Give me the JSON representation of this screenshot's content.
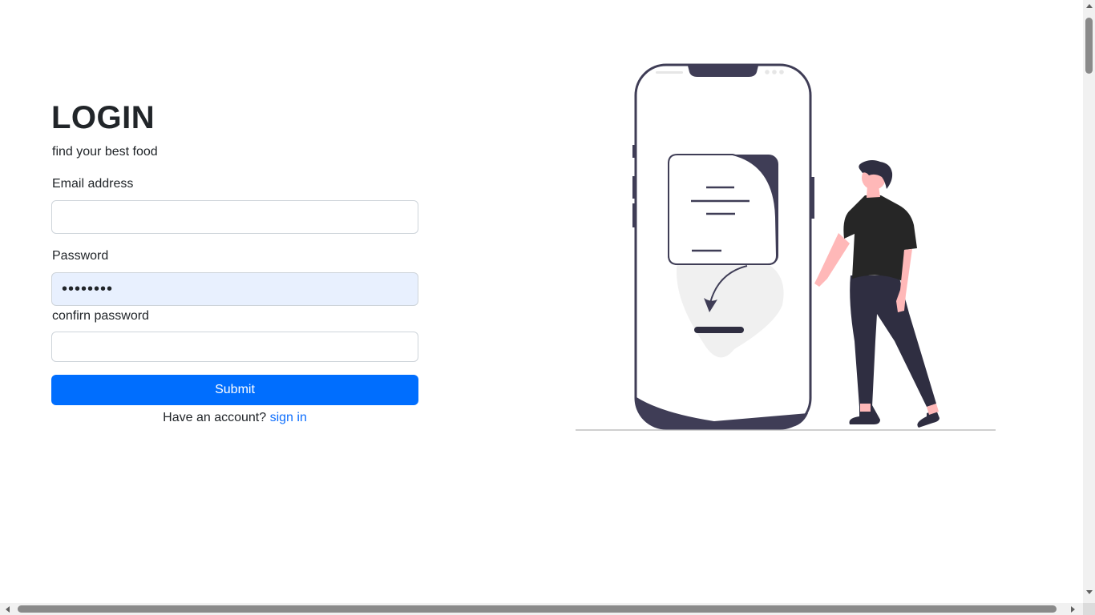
{
  "login": {
    "title": "LOGIN",
    "subtitle": "find your best food",
    "email_label": "Email address",
    "email_value": "",
    "password_label": "Password",
    "password_value": "••••••••",
    "confirm_label": "confirn password",
    "confirm_value": "",
    "submit_label": "Submit",
    "account_text": "Have an account?",
    "signin_link": "sign in"
  },
  "colors": {
    "primary": "#0d6efd",
    "autofill_bg": "#e8f0fe",
    "illustration_dark": "#3f3d56",
    "illustration_skin": "#ffb8b8"
  },
  "illustration": {
    "icon": "person-with-phone-illustration"
  }
}
